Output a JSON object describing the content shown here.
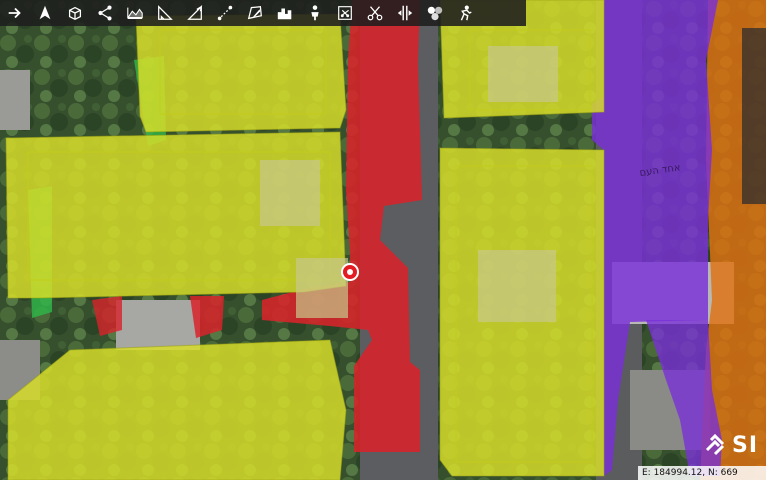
{
  "map": {
    "street_label": "אחד העם",
    "coordinates_readout": "E: 184994.12, N: 669",
    "logo_text": "SI",
    "colors": {
      "zone_yellow": "#d8de2a",
      "zone_red": "#d8232a",
      "zone_purple": "#7a2fd8",
      "zone_orange": "#e07010",
      "zone_green": "#2fb84a",
      "marker": "#e31b23",
      "toolbar_bg": "#1e1e1e",
      "toolbar_active": "#e53935"
    }
  },
  "toolbar": {
    "tools": [
      {
        "icon": "arrow-right-icon"
      },
      {
        "icon": "north-arrow-icon"
      },
      {
        "icon": "cube-3d-icon"
      },
      {
        "icon": "share-icon"
      },
      {
        "icon": "terrain-profile-icon"
      },
      {
        "icon": "angle-measure-icon"
      },
      {
        "icon": "slope-icon"
      },
      {
        "icon": "line-of-sight-icon"
      },
      {
        "icon": "draw-polygon-icon"
      },
      {
        "icon": "buildings-icon"
      },
      {
        "icon": "person-viewshed-icon"
      },
      {
        "icon": "clip-box-icon"
      },
      {
        "icon": "scissors-icon"
      },
      {
        "icon": "split-view-icon"
      },
      {
        "icon": "shadow-analysis-icon"
      },
      {
        "icon": "flythrough-icon"
      }
    ]
  }
}
